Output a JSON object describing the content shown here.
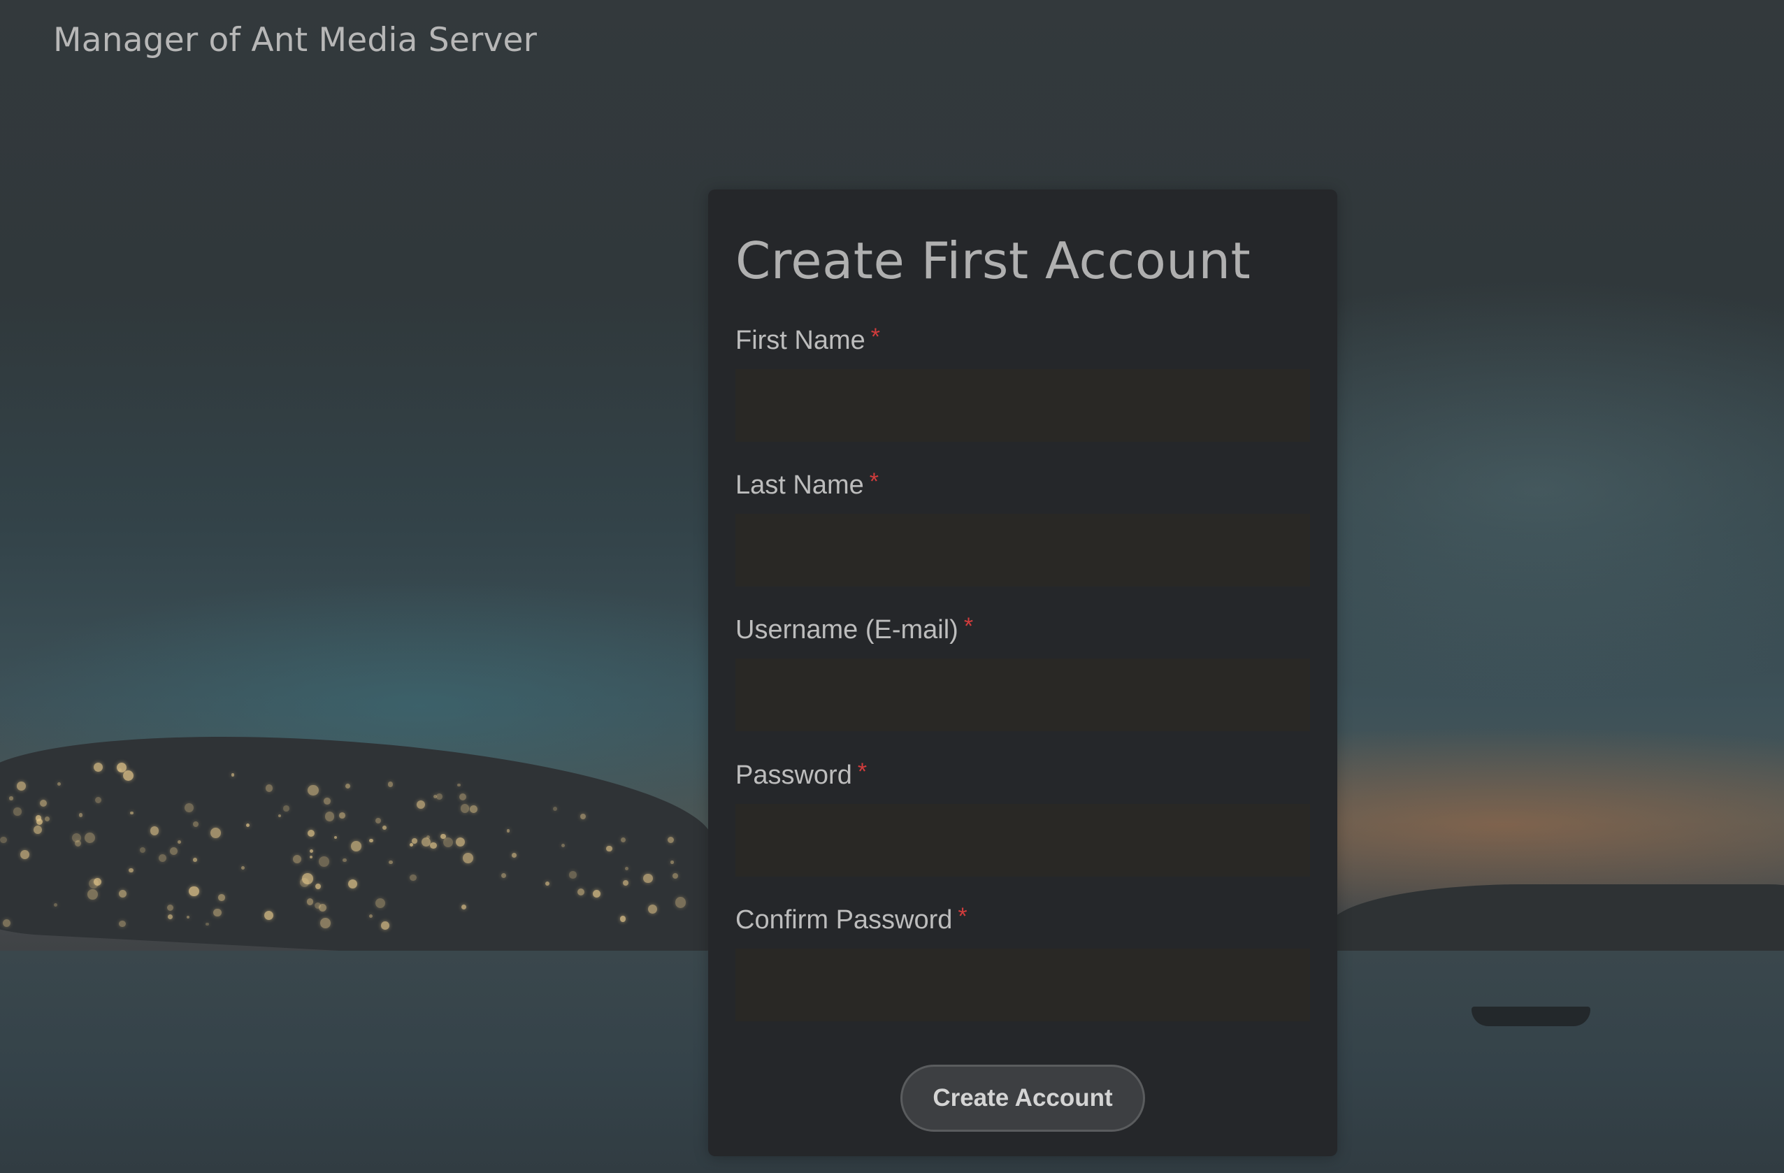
{
  "header": {
    "app_title": "Manager of Ant Media Server"
  },
  "form": {
    "title": "Create First Account",
    "required_marker": "*",
    "fields": [
      {
        "label": "First Name",
        "value": "",
        "placeholder": ""
      },
      {
        "label": "Last Name",
        "value": "",
        "placeholder": ""
      },
      {
        "label": "Username (E-mail)",
        "value": "",
        "placeholder": ""
      },
      {
        "label": "Password",
        "value": "",
        "placeholder": ""
      },
      {
        "label": "Confirm Password",
        "value": "",
        "placeholder": ""
      }
    ],
    "submit_label": "Create Account"
  },
  "colors": {
    "card_background": "#25272a",
    "input_background": "#292825",
    "required_marker": "#d23c3c",
    "button_background": "#3d3f42"
  }
}
